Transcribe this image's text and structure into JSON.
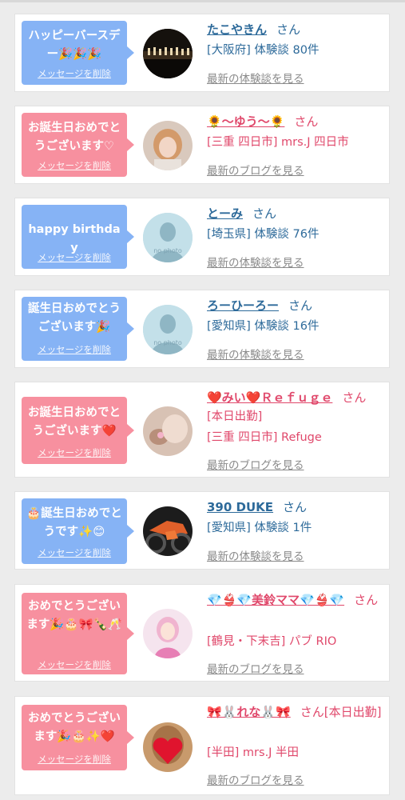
{
  "delete_label": "メッセージを削除",
  "san": "さん",
  "cards": [
    {
      "message": "ハッピーバースデー🎉🎉🎉",
      "name": "たこやきん",
      "lines": [
        "[大阪府] 体験談 80件"
      ],
      "link": "最新の体験談を見る",
      "theme": "blue",
      "avatar": "stage-photo"
    },
    {
      "message": "お誕生日おめでとうございます♡",
      "name": "🌻〜ゆう〜🌻",
      "lines": [
        "[三重 四日市] mrs.J 四日市"
      ],
      "link": "最新のブログを見る",
      "theme": "pink",
      "avatar": "girl-photo"
    },
    {
      "message": "happy birthday",
      "name": "とーみ",
      "lines": [
        "[埼玉県] 体験談 76件"
      ],
      "link": "最新の体験談を見る",
      "theme": "blue",
      "avatar": "no-photo",
      "avatar_text": "no photo"
    },
    {
      "message": "誕生日おめでとうございます🎉",
      "name": "ろーひーろー",
      "lines": [
        "[愛知県] 体験談 16件"
      ],
      "link": "最新の体験談を見る",
      "theme": "blue",
      "avatar": "no-photo",
      "avatar_text": "no photo"
    },
    {
      "message": "お誕生日おめでとうございます❤️",
      "name": "❤️みい❤️Ｒｅｆｕｇｅ",
      "lines": [
        "[本日出勤]",
        "[三重 四日市] Refuge"
      ],
      "link": "最新のブログを見る",
      "theme": "pink",
      "avatar": "girl-photo"
    },
    {
      "message": "🎂誕生日おめでとうです✨😊",
      "name": "390 DUKE",
      "lines": [
        "[愛知県] 体験談 1件"
      ],
      "link": "最新の体験談を見る",
      "theme": "blue",
      "avatar": "motorbike-photo"
    },
    {
      "message": "おめでとうございます🎉🎂🎀🍾🥂",
      "name": "💎👙💎美鈴ママ💎👙💎",
      "lines": [
        "[鶴見・下末吉] パブ RIO"
      ],
      "link": "最新のブログを見る",
      "theme": "pink",
      "avatar": "girl-pink-photo"
    },
    {
      "message": "おめでとうございます🎉🎂✨❤️",
      "name": "🎀🐰れな🐰🎀",
      "lines": [
        "[半田] mrs.J 半田"
      ],
      "name_suffix": "[本日出勤]",
      "link": "最新のブログを見る",
      "theme": "pink",
      "avatar": "heart-photo"
    }
  ],
  "colors": {
    "bubble_blue": "#86b3f5",
    "bubble_pink": "#f7909f",
    "name_blue": "#2d6a9a",
    "name_pink": "#e0486b",
    "link_gray": "#8a8a8a"
  }
}
